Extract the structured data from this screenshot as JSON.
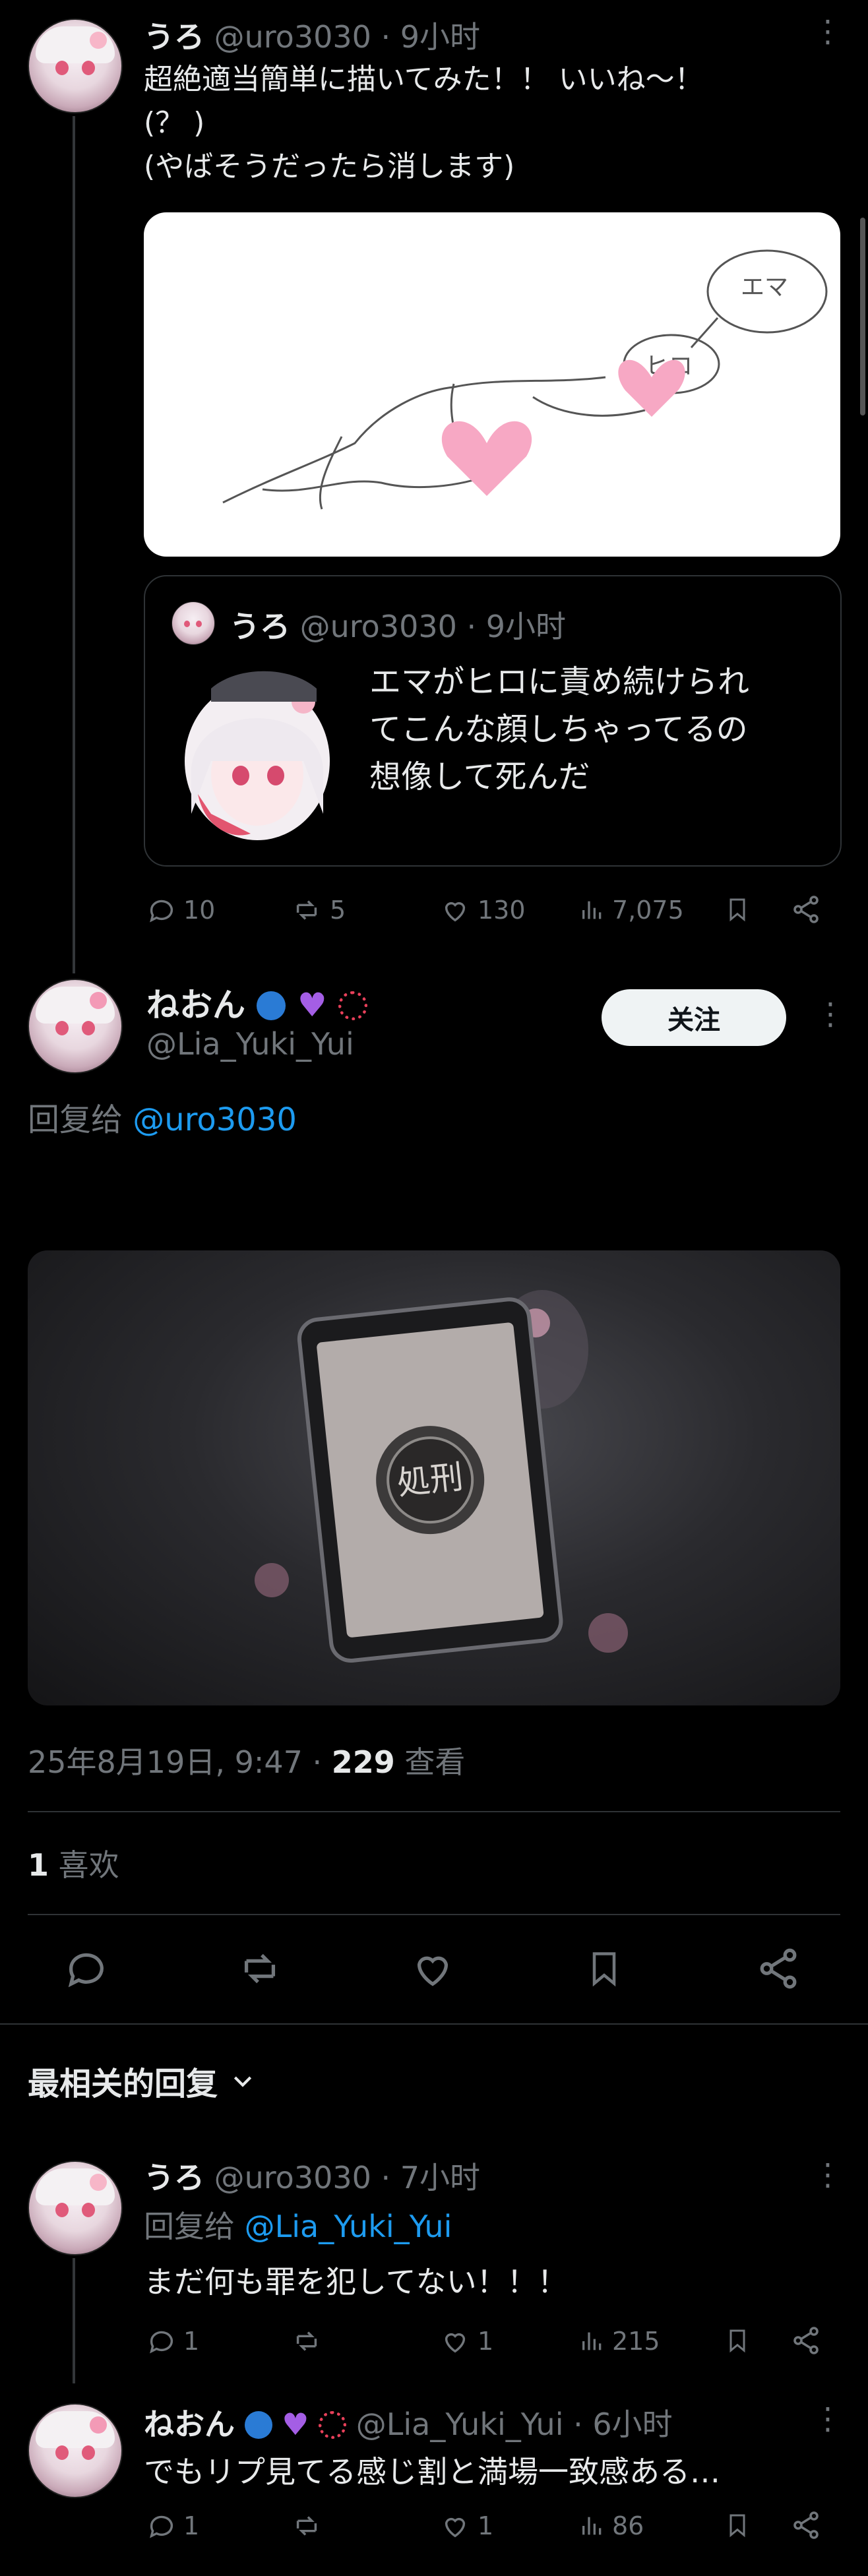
{
  "post1": {
    "name": "うろ",
    "handle": "@uro3030",
    "time": "· 9小时",
    "text_line1": "超絶適当簡単に描いてみた！！ いいね～！",
    "text_line2": "(？ )",
    "text_line3": "(やばそうだったら消します)",
    "drawing_labels": {
      "bubble1": "エマ",
      "bubble2": "ヒロ"
    },
    "quote": {
      "name": "うろ",
      "handle": "@uro3030",
      "time": "· 9小时",
      "line1": "エマがヒロに責め続けられ",
      "line2": "てこんな顔しちゃってるの",
      "line3": "想像して死んだ"
    },
    "replies": "10",
    "reposts": "5",
    "likes": "130",
    "views": "7,075"
  },
  "main_post": {
    "name": "ねおん",
    "handle": "@Lia_Yuki_Yui",
    "follow_label": "关注",
    "reply_prefix": "回复给 ",
    "reply_to": "@uro3030",
    "media_text": "処刑",
    "date": "25年8月19日, 9:47 · ",
    "views_count": "229",
    "views_label": " 查看",
    "likes_count": "1",
    "likes_label": " 喜欢"
  },
  "sort": {
    "label": "最相关的回复"
  },
  "reply1": {
    "name": "うろ",
    "handle": "@uro3030",
    "time": "· 7小时",
    "reply_prefix": "回复给 ",
    "reply_to": "@Lia_Yuki_Yui",
    "text": "まだ何も罪を犯してない！！！",
    "replies": "1",
    "likes": "1",
    "views": "215"
  },
  "reply2": {
    "name": "ねおん",
    "handle": "@Lia_Yuki_Yui",
    "time": "· 6小时",
    "text": "でもリプ見てる感じ割と満場一致感ある…",
    "replies": "1",
    "likes": "1",
    "views": "86"
  },
  "colors": {
    "accent": "#1d9bf0",
    "muted": "#71767b",
    "heart": "#f7a8c4"
  }
}
